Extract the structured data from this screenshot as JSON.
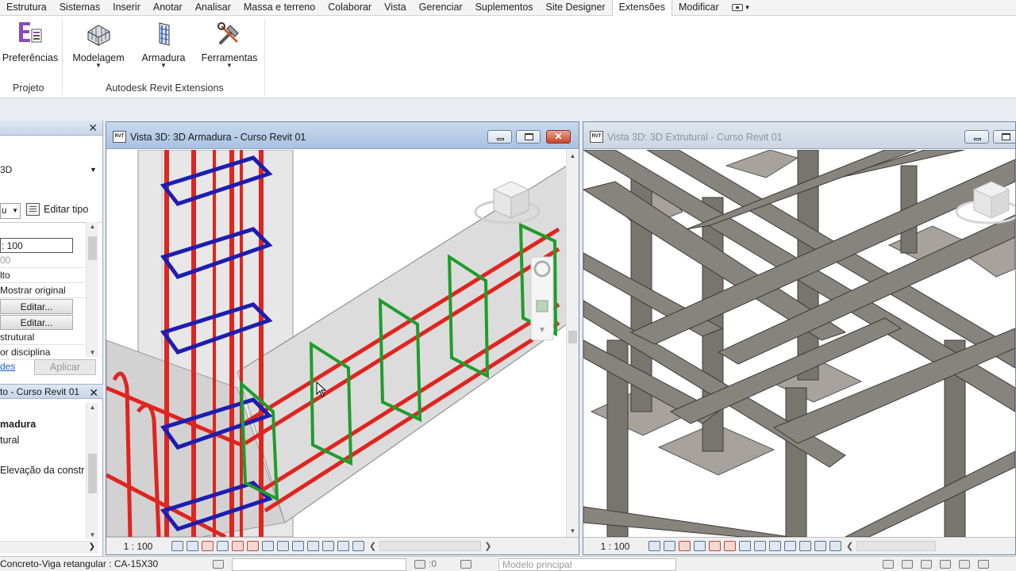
{
  "ribbon_tabs": [
    {
      "label": "Estrutura"
    },
    {
      "label": "Sistemas"
    },
    {
      "label": "Inserir"
    },
    {
      "label": "Anotar"
    },
    {
      "label": "Analisar"
    },
    {
      "label": "Massa e terreno"
    },
    {
      "label": "Colaborar"
    },
    {
      "label": "Vista"
    },
    {
      "label": "Gerenciar"
    },
    {
      "label": "Suplementos"
    },
    {
      "label": "Site Designer"
    },
    {
      "label": "Extensões"
    },
    {
      "label": "Modificar"
    }
  ],
  "active_tab": "Extensões",
  "ribbon": {
    "buttons": [
      {
        "label": "Preferências",
        "icon": "extensions-preferences-icon"
      },
      {
        "label": "Modelagem",
        "icon": "modeling-icon"
      },
      {
        "label": "Armadura",
        "icon": "rebar-icon"
      },
      {
        "label": "Ferramentas",
        "icon": "tools-icon"
      }
    ],
    "groups": [
      "Projeto",
      "Autodesk Revit Extensions"
    ],
    "accent": "#8a4bb8"
  },
  "properties": {
    "type_name": "3D",
    "combo_text": "u",
    "edit_type_label": "Editar tipo",
    "rows": [
      {
        "value": ": 100"
      },
      {
        "value": "00"
      },
      {
        "value": "lto"
      },
      {
        "value": "Mostrar original"
      },
      {
        "value": "Editar..."
      },
      {
        "value": "Editar..."
      },
      {
        "value": "strutural"
      },
      {
        "value": "or disciplina"
      }
    ],
    "help_link": "des",
    "apply_label": "Aplicar"
  },
  "project_browser": {
    "title": "to - Curso Revit 01",
    "items": [
      "madura",
      "tural",
      "Elevação da constr"
    ]
  },
  "views": [
    {
      "title": "Vista 3D: 3D Armadura - Curso Revit 01",
      "scale": "1 : 100",
      "active": true
    },
    {
      "title": "Vista 3D: 3D Extrutural - Curso Revit 01",
      "scale": "1 : 100",
      "active": false
    }
  ],
  "status": {
    "selection": "Concreto-Viga retangular : CA-15X30",
    "zero_label": ":0",
    "model": "Modelo principal"
  },
  "colors": {
    "rebar_longitudinal": "#e0241f",
    "stirrup_column": "#1d1db0",
    "stirrup_beam": "#1e9d2a",
    "concrete": "#6d6c66"
  }
}
